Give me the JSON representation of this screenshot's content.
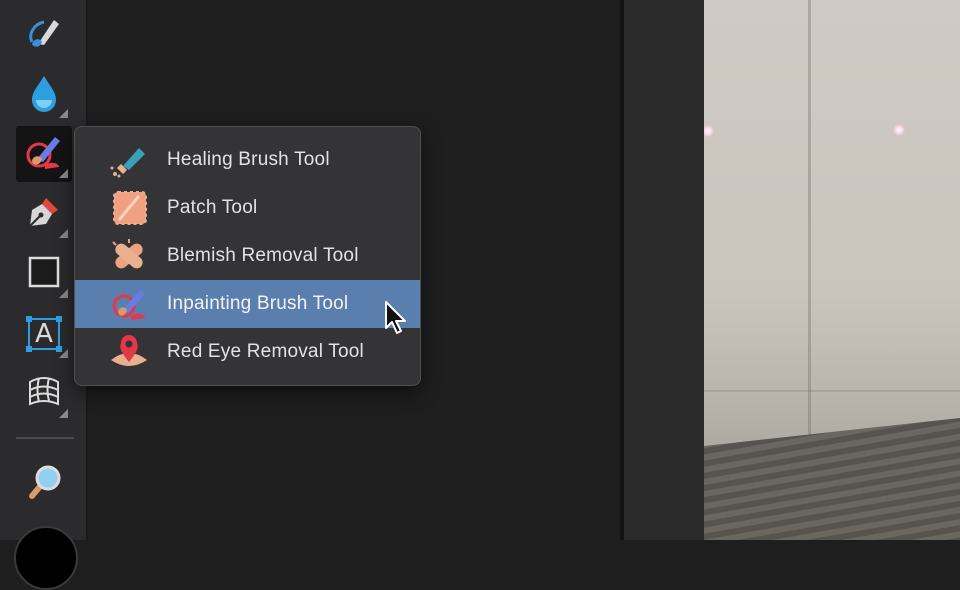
{
  "toolbar": {
    "tools": [
      {
        "name": "brush-tool",
        "icon": "paintbrush-icon"
      },
      {
        "name": "fill-tool",
        "icon": "water-drop-icon"
      },
      {
        "name": "inpainting-tool",
        "icon": "inpainting-brush-icon"
      },
      {
        "name": "pen-tool",
        "icon": "pen-nib-icon"
      },
      {
        "name": "rectangle-tool",
        "icon": "rectangle-icon"
      },
      {
        "name": "text-tool",
        "icon": "text-a-icon"
      },
      {
        "name": "mesh-warp-tool",
        "icon": "mesh-warp-icon"
      },
      {
        "name": "zoom-tool",
        "icon": "magnifier-icon"
      }
    ],
    "text_tool_glyph": "A"
  },
  "flyout": {
    "items": [
      {
        "label": "Healing Brush Tool",
        "icon": "healing-brush-icon",
        "highlighted": false
      },
      {
        "label": "Patch Tool",
        "icon": "patch-icon",
        "highlighted": false
      },
      {
        "label": "Blemish Removal Tool",
        "icon": "bandage-icon",
        "highlighted": false
      },
      {
        "label": "Inpainting Brush Tool",
        "icon": "inpainting-brush-icon",
        "highlighted": true
      },
      {
        "label": "Red Eye Removal Tool",
        "icon": "red-eye-icon",
        "highlighted": false
      }
    ]
  },
  "colors": {
    "highlight": "#5a7ead",
    "panel": "#343436",
    "toolbar": "#2b2b2d"
  }
}
